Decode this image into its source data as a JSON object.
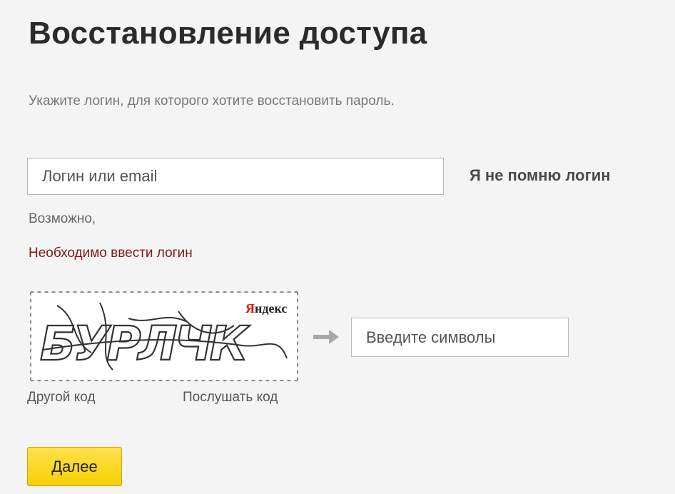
{
  "page": {
    "title": "Восстановление доступа",
    "instruction": "Укажите логин, для которого хотите восстановить пароль."
  },
  "login": {
    "placeholder": "Логин или email",
    "value": "",
    "forgot_link": "Я не помню логин"
  },
  "messages": {
    "maybe": "Возможно,",
    "error": "Необходимо ввести логин"
  },
  "captcha": {
    "brand": "Яндекс",
    "image_text": "БУРЛЧК",
    "input_placeholder": "Введите символы",
    "other_code": "Другой код",
    "listen_code": "Послушать код",
    "arrow_icon": "arrow-right-icon"
  },
  "actions": {
    "next_label": "Далее"
  },
  "colors": {
    "background": "#f4f4f4",
    "error": "#7a1a1a",
    "button_yellow": "#ffdb2e",
    "brand_red": "#e61400"
  }
}
